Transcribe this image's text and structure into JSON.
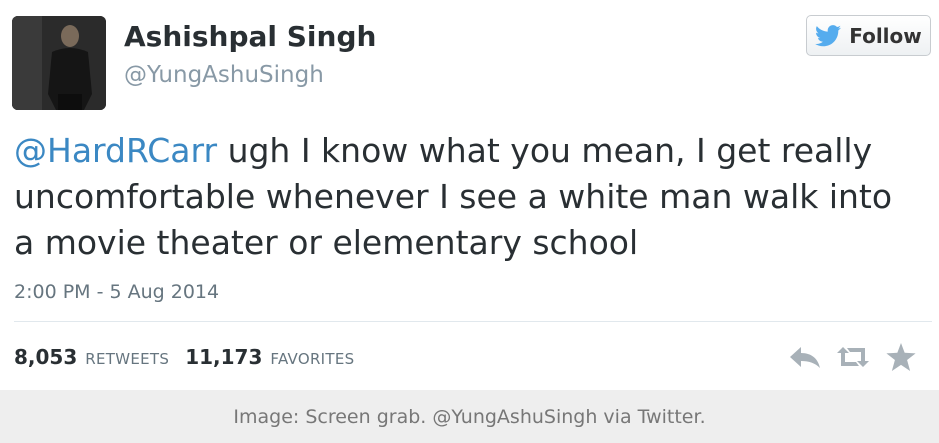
{
  "tweet": {
    "author_name": "Ashishpal Singh",
    "author_handle": "@YungAshuSingh",
    "follow_label": "Follow",
    "mention": "@HardRCarr",
    "body": " ugh I know what you mean, I get really uncomfortable whenever I see a white man walk into a movie theater or elementary school",
    "timestamp": "2:00 PM - 5 Aug 2014",
    "retweets_count": "8,053",
    "retweets_label": "RETWEETS",
    "favorites_count": "11,173",
    "favorites_label": "FAVORITES",
    "icons": {
      "follow": "twitter-bird-icon",
      "reply": "reply-icon",
      "retweet": "retweet-icon",
      "favorite": "star-icon"
    }
  },
  "caption": "Image: Screen grab. @YungAshuSingh via Twitter.",
  "colors": {
    "link": "#3b88c3",
    "bird": "#55acee",
    "icon_gray": "#a8b1b8"
  }
}
